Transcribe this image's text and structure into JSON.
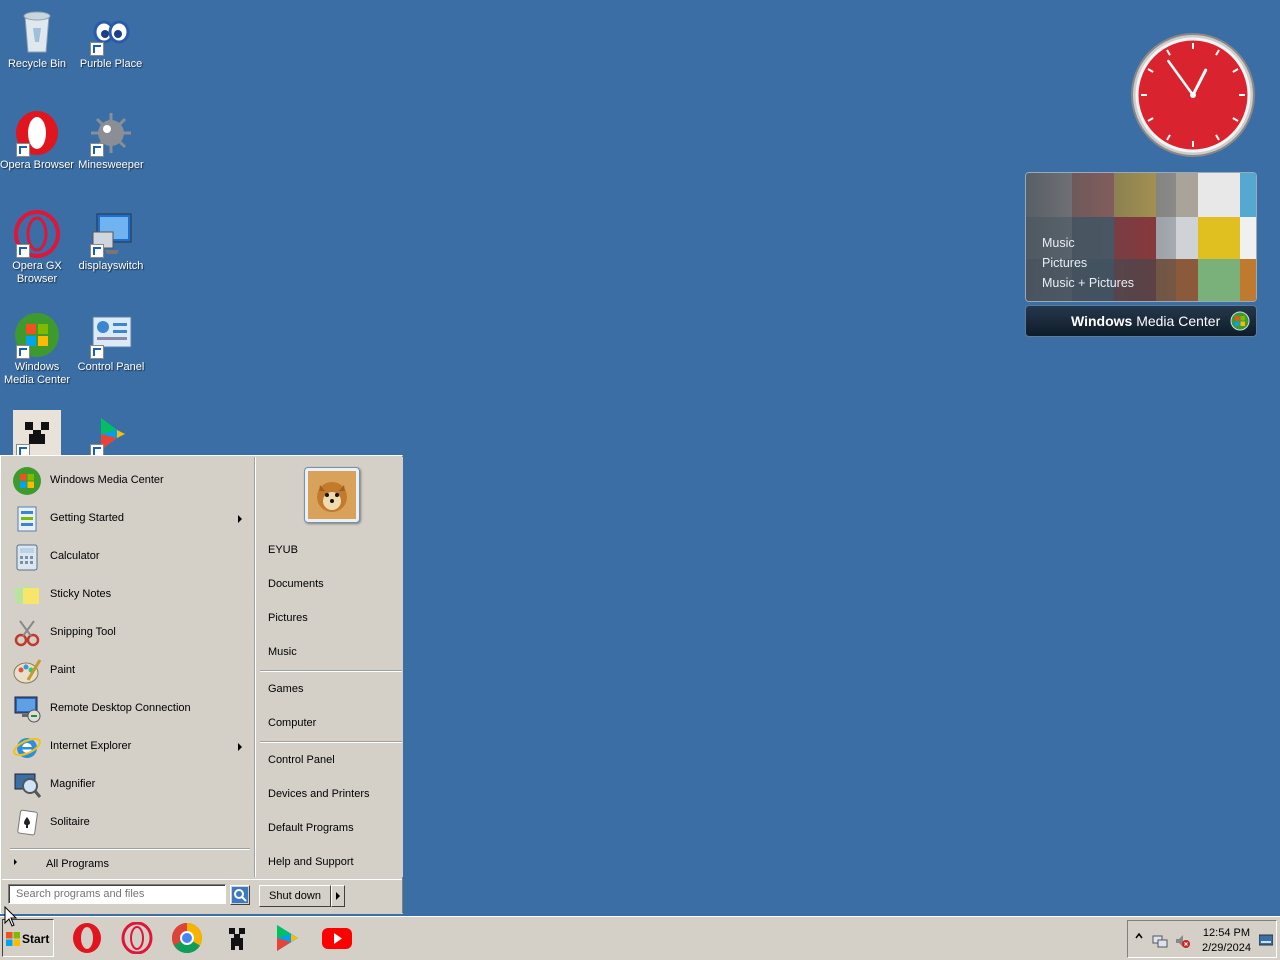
{
  "desktop": {
    "icons": [
      {
        "label": "Recycle Bin"
      },
      {
        "label": "Purble Place"
      },
      {
        "label": "Opera Browser"
      },
      {
        "label": "Minesweeper"
      },
      {
        "label": "Opera GX Browser"
      },
      {
        "label": "displayswitch"
      },
      {
        "label": "Windows Media Center"
      },
      {
        "label": "Control Panel"
      },
      {
        "label": ""
      },
      {
        "label": ""
      }
    ]
  },
  "gadgets": {
    "media_center": {
      "menu": [
        "Music",
        "Pictures",
        "Music + Pictures"
      ],
      "title_bold": "Windows",
      "title_rest": " Media Center"
    },
    "clock": {
      "hour": 12,
      "minute": 54,
      "face_color": "#d9232e"
    }
  },
  "start_menu": {
    "programs": [
      {
        "label": "Windows Media Center",
        "submenu": false
      },
      {
        "label": "Getting Started",
        "submenu": true
      },
      {
        "label": "Calculator",
        "submenu": false
      },
      {
        "label": "Sticky Notes",
        "submenu": false
      },
      {
        "label": "Snipping Tool",
        "submenu": false
      },
      {
        "label": "Paint",
        "submenu": false
      },
      {
        "label": "Remote Desktop Connection",
        "submenu": false
      },
      {
        "label": "Internet Explorer",
        "submenu": true
      },
      {
        "label": "Magnifier",
        "submenu": false
      },
      {
        "label": "Solitaire",
        "submenu": false
      }
    ],
    "all_programs": "All Programs",
    "right_links": [
      "EYUB",
      "Documents",
      "Pictures",
      "Music",
      "Games",
      "Computer",
      "Control Panel",
      "Devices and Printers",
      "Default Programs",
      "Help and Support"
    ],
    "search_placeholder": "Search programs and files",
    "shutdown_label": "Shut down"
  },
  "taskbar": {
    "start_label": "Start",
    "apps": [
      "opera-icon",
      "opera-gx-icon",
      "chrome-icon",
      "minecraft-icon",
      "google-play-icon",
      "youtube-icon"
    ],
    "clock_time": "12:54 PM",
    "clock_date": "2/29/2024"
  },
  "colors": {
    "desktop": "#3a6ea5",
    "classic_gray": "#d4d0c8"
  }
}
